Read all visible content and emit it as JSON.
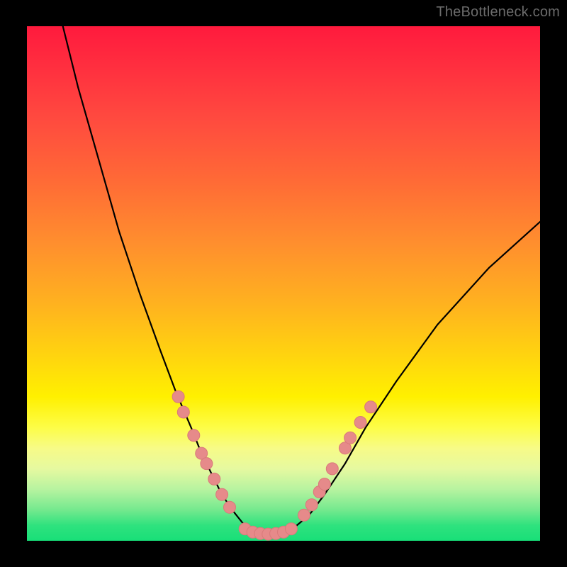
{
  "watermark": "TheBottleneck.com",
  "colors": {
    "frame": "#000000",
    "curve_stroke": "#000000",
    "dot_fill": "#e68a8a",
    "dot_stroke": "#d97a7a"
  },
  "chart_data": {
    "type": "line",
    "title": "",
    "xlabel": "",
    "ylabel": "",
    "xlim": [
      0,
      100
    ],
    "ylim": [
      0,
      100
    ],
    "grid": false,
    "series": [
      {
        "name": "bottleneck-curve",
        "x": [
          7,
          10,
          14,
          18,
          22,
          26,
          29,
          32,
          34,
          36,
          38,
          40,
          42,
          44,
          46,
          48,
          50,
          52,
          55,
          58,
          62,
          66,
          72,
          80,
          90,
          100
        ],
        "y": [
          100,
          88,
          74,
          60,
          48,
          37,
          29,
          22,
          17,
          13,
          9,
          6,
          3.5,
          2,
          1.3,
          1.2,
          1.6,
          2.5,
          5,
          9,
          15,
          22,
          31,
          42,
          53,
          62
        ]
      }
    ],
    "markers": [
      {
        "series": "bottleneck-curve",
        "name": "left-arm-dots",
        "points": [
          {
            "x": 29.5,
            "y": 28
          },
          {
            "x": 30.5,
            "y": 25
          },
          {
            "x": 32.5,
            "y": 20.5
          },
          {
            "x": 34.0,
            "y": 17
          },
          {
            "x": 35.0,
            "y": 15
          },
          {
            "x": 36.5,
            "y": 12
          },
          {
            "x": 38.0,
            "y": 9
          },
          {
            "x": 39.5,
            "y": 6.5
          }
        ]
      },
      {
        "series": "bottleneck-curve",
        "name": "valley-floor-dots",
        "points": [
          {
            "x": 42.5,
            "y": 2.3
          },
          {
            "x": 44.0,
            "y": 1.7
          },
          {
            "x": 45.5,
            "y": 1.4
          },
          {
            "x": 47.0,
            "y": 1.3
          },
          {
            "x": 48.5,
            "y": 1.4
          },
          {
            "x": 50.0,
            "y": 1.7
          },
          {
            "x": 51.5,
            "y": 2.3
          }
        ]
      },
      {
        "series": "bottleneck-curve",
        "name": "right-arm-dots",
        "points": [
          {
            "x": 54.0,
            "y": 5
          },
          {
            "x": 55.5,
            "y": 7
          },
          {
            "x": 57.0,
            "y": 9.5
          },
          {
            "x": 58.0,
            "y": 11
          },
          {
            "x": 59.5,
            "y": 14
          },
          {
            "x": 62.0,
            "y": 18
          },
          {
            "x": 63.0,
            "y": 20
          },
          {
            "x": 65.0,
            "y": 23
          },
          {
            "x": 67.0,
            "y": 26
          }
        ]
      }
    ]
  }
}
